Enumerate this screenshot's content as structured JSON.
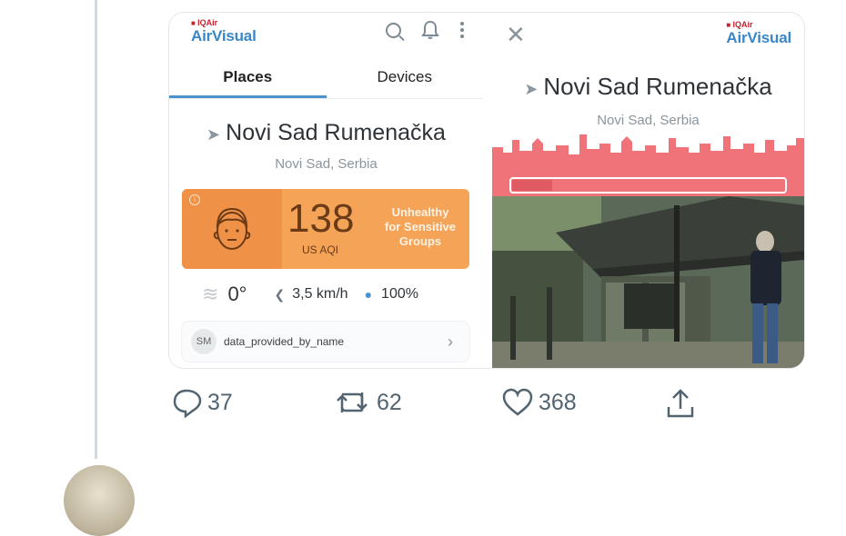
{
  "app": {
    "brand_small": "IQAir",
    "brand_large": "AirVisual"
  },
  "tabs": [
    {
      "label": "Places",
      "active": true
    },
    {
      "label": "Devices",
      "active": false
    }
  ],
  "place": {
    "name": "Novi Sad Rumenačka",
    "region": "Novi Sad, Serbia"
  },
  "aqi": {
    "value": "138",
    "unit": "US AQI",
    "level_line1": "Unhealthy",
    "level_line2": "for Sensitive",
    "level_line3": "Groups",
    "color": "#f4a357"
  },
  "weather": {
    "temperature": "0°",
    "wind": "3,5 km/h",
    "humidity": "100%"
  },
  "provider": {
    "initials": "SM",
    "name": "data_provided_by_name"
  },
  "detail": {
    "brand_small": "IQAir",
    "brand_large": "AirVisual",
    "place_name": "Novi Sad Rumenačka",
    "region": "Novi Sad, Serbia",
    "skyline_color": "#f0737a"
  },
  "tweet_actions": {
    "replies": "37",
    "retweets": "62",
    "likes": "368"
  },
  "icons": [
    "search-icon",
    "bell-icon",
    "more-vertical-icon",
    "location-arrow-icon",
    "face-icon",
    "wind-icon",
    "droplet-icon",
    "chevron-right-icon",
    "close-icon",
    "reply-icon",
    "retweet-icon",
    "like-icon",
    "share-icon"
  ]
}
